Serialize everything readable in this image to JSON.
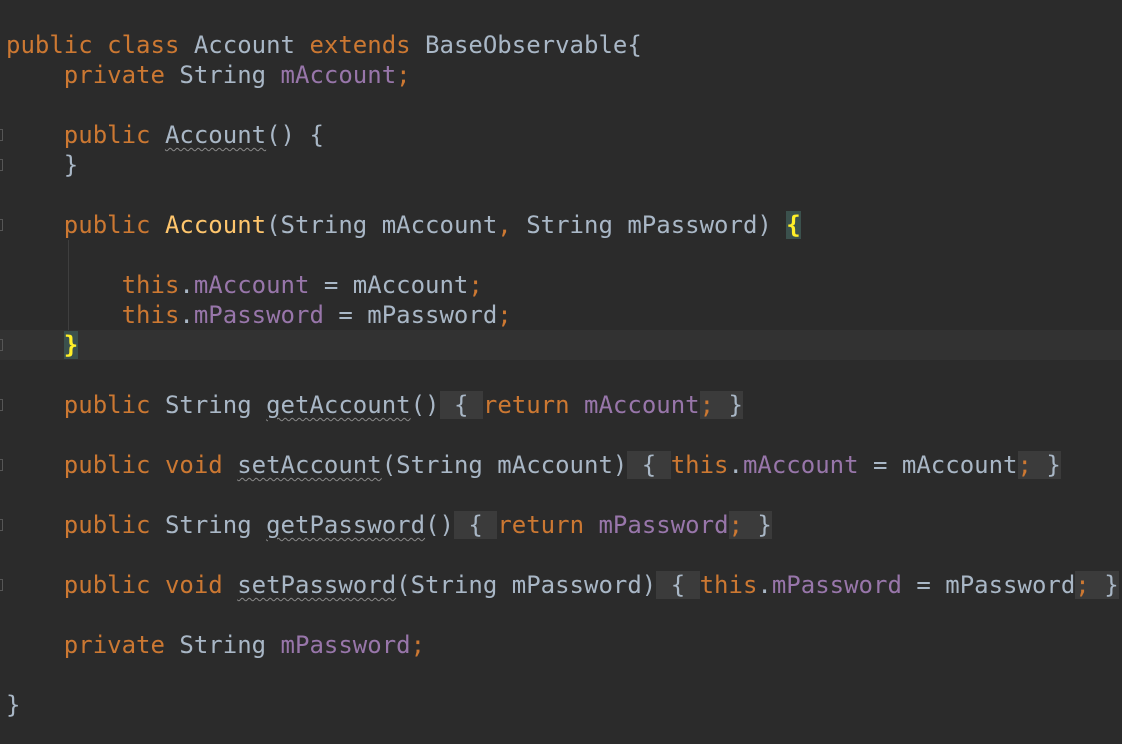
{
  "editor": {
    "theme": "Darcula",
    "colors": {
      "background": "#2b2b2b",
      "keyword": "#cc7832",
      "field": "#9876aa",
      "method_declaration": "#ffc66d",
      "plain": "#a9b7c6",
      "matched_brace": "#ffef28",
      "current_line": "#323232"
    },
    "lines": [
      {
        "segments": [
          {
            "text": "public ",
            "type": "kw"
          },
          {
            "text": "class ",
            "type": "kw"
          },
          {
            "text": "Account ",
            "type": "plain"
          },
          {
            "text": "extends ",
            "type": "kw"
          },
          {
            "text": "BaseObservable{",
            "type": "plain"
          }
        ]
      },
      {
        "segments": [
          {
            "text": "    private ",
            "type": "kw"
          },
          {
            "text": "String ",
            "type": "plain"
          },
          {
            "text": "mAccount",
            "type": "fld"
          },
          {
            "text": ";",
            "type": "kw"
          }
        ]
      },
      {
        "segments": []
      },
      {
        "gutter": true,
        "segments": [
          {
            "text": "    public ",
            "type": "kw"
          },
          {
            "text": "Account",
            "type": "plain",
            "squiggle": true
          },
          {
            "text": "() {",
            "type": "plain"
          }
        ]
      },
      {
        "gutter": true,
        "segments": [
          {
            "text": "    }",
            "type": "plain"
          }
        ]
      },
      {
        "segments": []
      },
      {
        "gutter": true,
        "segments": [
          {
            "text": "    public ",
            "type": "kw"
          },
          {
            "text": "Account",
            "type": "fn"
          },
          {
            "text": "(String mAccount",
            "type": "plain"
          },
          {
            "text": ", ",
            "type": "kw"
          },
          {
            "text": "String mPassword) ",
            "type": "plain"
          },
          {
            "text": "{",
            "type": "brace-hl"
          }
        ]
      },
      {
        "segments": []
      },
      {
        "segments": [
          {
            "text": "        this",
            "type": "kw"
          },
          {
            "text": ".",
            "type": "plain"
          },
          {
            "text": "mAccount",
            "type": "fld"
          },
          {
            "text": " = mAccount",
            "type": "plain"
          },
          {
            "text": ";",
            "type": "kw"
          }
        ]
      },
      {
        "segments": [
          {
            "text": "        this",
            "type": "kw"
          },
          {
            "text": ".",
            "type": "plain"
          },
          {
            "text": "mPassword",
            "type": "fld"
          },
          {
            "text": " = mPassword",
            "type": "plain"
          },
          {
            "text": ";",
            "type": "kw"
          }
        ]
      },
      {
        "current": true,
        "gutter": true,
        "segments": [
          {
            "text": "    ",
            "type": "plain"
          },
          {
            "text": "}",
            "type": "brace-hl"
          }
        ]
      },
      {
        "segments": []
      },
      {
        "gutter": true,
        "segments": [
          {
            "text": "    public ",
            "type": "kw"
          },
          {
            "text": "String ",
            "type": "plain"
          },
          {
            "text": "getAccount",
            "type": "plain",
            "squiggle": true
          },
          {
            "text": "()",
            "type": "plain"
          },
          {
            "text": " { ",
            "type": "fold"
          },
          {
            "text": "return ",
            "type": "kw"
          },
          {
            "text": "mAccount",
            "type": "fld"
          },
          {
            "text": ";",
            "type": "fold-k"
          },
          {
            "text": " }",
            "type": "fold"
          }
        ]
      },
      {
        "segments": []
      },
      {
        "gutter": true,
        "segments": [
          {
            "text": "    public ",
            "type": "kw"
          },
          {
            "text": "void ",
            "type": "kw"
          },
          {
            "text": "setAccount",
            "type": "plain",
            "squiggle": true
          },
          {
            "text": "(String mAccount)",
            "type": "plain"
          },
          {
            "text": " { ",
            "type": "fold"
          },
          {
            "text": "this",
            "type": "kw"
          },
          {
            "text": ".",
            "type": "plain"
          },
          {
            "text": "mAccount",
            "type": "fld"
          },
          {
            "text": " = mAccount",
            "type": "plain"
          },
          {
            "text": ";",
            "type": "fold-k"
          },
          {
            "text": " }",
            "type": "fold"
          }
        ]
      },
      {
        "segments": []
      },
      {
        "gutter": true,
        "segments": [
          {
            "text": "    public ",
            "type": "kw"
          },
          {
            "text": "String ",
            "type": "plain"
          },
          {
            "text": "getPassword",
            "type": "plain",
            "squiggle": true
          },
          {
            "text": "()",
            "type": "plain"
          },
          {
            "text": " { ",
            "type": "fold"
          },
          {
            "text": "return ",
            "type": "kw"
          },
          {
            "text": "mPassword",
            "type": "fld"
          },
          {
            "text": ";",
            "type": "fold-k"
          },
          {
            "text": " }",
            "type": "fold"
          }
        ]
      },
      {
        "segments": []
      },
      {
        "gutter": true,
        "segments": [
          {
            "text": "    public ",
            "type": "kw"
          },
          {
            "text": "void ",
            "type": "kw"
          },
          {
            "text": "setPassword",
            "type": "plain",
            "squiggle": true
          },
          {
            "text": "(String mPassword)",
            "type": "plain"
          },
          {
            "text": " { ",
            "type": "fold"
          },
          {
            "text": "this",
            "type": "kw"
          },
          {
            "text": ".",
            "type": "plain"
          },
          {
            "text": "mPassword",
            "type": "fld"
          },
          {
            "text": " = mPassword",
            "type": "plain"
          },
          {
            "text": ";",
            "type": "fold-k"
          },
          {
            "text": " }",
            "type": "fold"
          }
        ]
      },
      {
        "segments": []
      },
      {
        "segments": [
          {
            "text": "    private ",
            "type": "kw"
          },
          {
            "text": "String ",
            "type": "plain"
          },
          {
            "text": "mPassword",
            "type": "fld"
          },
          {
            "text": ";",
            "type": "kw"
          }
        ]
      },
      {
        "segments": []
      },
      {
        "segments": [
          {
            "text": "}",
            "type": "plain"
          }
        ]
      }
    ]
  }
}
